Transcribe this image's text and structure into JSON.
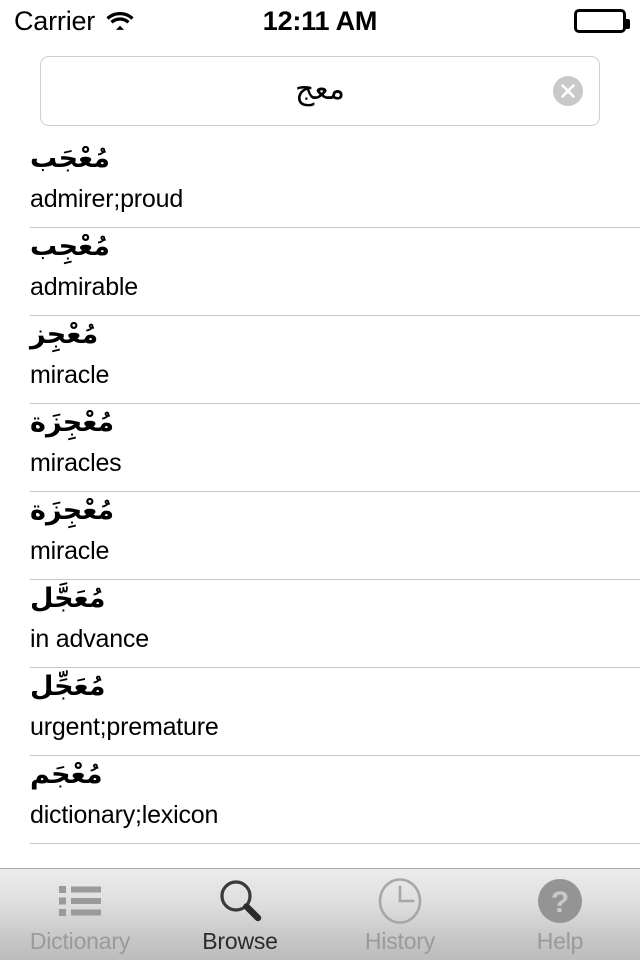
{
  "status_bar": {
    "carrier": "Carrier",
    "wifi_icon": "wifi-icon",
    "time": "12:11 AM",
    "battery_icon": "battery-full-icon"
  },
  "search": {
    "value": "معج",
    "placeholder": "",
    "clear_icon": "clear-circle-icon"
  },
  "results": [
    {
      "term": "مُعْجَب",
      "meaning": "admirer;proud"
    },
    {
      "term": "مُعْجِب",
      "meaning": "admirable"
    },
    {
      "term": "مُعْجِز",
      "meaning": "miracle"
    },
    {
      "term": "مُعْجِزَة",
      "meaning": "miracles"
    },
    {
      "term": "مُعْجِزَة",
      "meaning": "miracle"
    },
    {
      "term": "مُعَجَّل",
      "meaning": "in advance"
    },
    {
      "term": "مُعَجِّل",
      "meaning": "urgent;premature"
    },
    {
      "term": "مُعْجَم",
      "meaning": "dictionary;lexicon"
    }
  ],
  "tab_bar": {
    "items": [
      {
        "label": "Dictionary",
        "icon": "list-icon",
        "active": false
      },
      {
        "label": "Browse",
        "icon": "search-icon",
        "active": true
      },
      {
        "label": "History",
        "icon": "clock-icon",
        "active": false
      },
      {
        "label": "Help",
        "icon": "question-circle-icon",
        "active": false
      }
    ]
  },
  "colors": {
    "active_tab": "#2b2b2b",
    "inactive_tab": "#9a9a9a",
    "separator": "#c8c8c8",
    "clear_button": "#c9c9c9"
  }
}
